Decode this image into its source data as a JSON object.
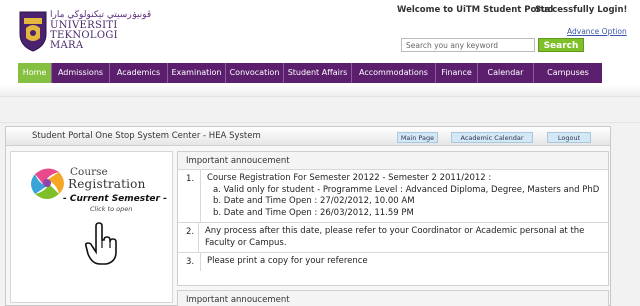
{
  "header": {
    "logo_jawi": "ڤونيۏرسيتي تيكنولوڬي مارا",
    "logo_lines": [
      "UNIVERSITI",
      "TEKNOLOGI",
      "MARA"
    ],
    "welcome": "Welcome to UiTM Student Portal",
    "logged_in": "Successfully Login!",
    "advance_option": "Advance Option",
    "search_placeholder": "Search you any keyword",
    "search_button": "Search"
  },
  "nav": {
    "items": [
      "Home",
      "Admissions",
      "Academics",
      "Examination",
      "Convocation",
      "Student Affairs",
      "Accommodations",
      "Finance",
      "Calendar",
      "Campuses"
    ],
    "active": "Home"
  },
  "portal": {
    "title": "Student Portal One Stop System Center  - HEA System",
    "buttons": [
      "Main Page",
      "Academic Calendar",
      "Logout"
    ]
  },
  "course_registration": {
    "line1": "Course",
    "line2": "Registration",
    "semester": "- Current Semester -",
    "click": "Click to open"
  },
  "announcement": {
    "heading": "Important annoucement",
    "items": [
      {
        "num": "1.",
        "text": "Course Registration For Semester 20122 - Semester 2 2011/2012 :",
        "sub": [
          "a. Valid only for student - Programme Level : Advanced Diploma, Degree, Masters and PhD",
          "b. Date and Time Open : 27/02/2012, 10.00 AM",
          "b. Date and Time Open : 26/03/2012, 11.59 PM"
        ]
      },
      {
        "num": "2.",
        "text": "Any process after this date, please refer to your Coordinator or Academic personal at the Faculty or Campus.",
        "sub": []
      },
      {
        "num": "3.",
        "text": "Please print a copy for your reference",
        "sub": []
      }
    ]
  },
  "announcement2": {
    "heading": "Important annoucement"
  },
  "colors": {
    "nav_bg": "#5c1f6e",
    "nav_active": "#86c040",
    "search_button": "#7fbf2a"
  }
}
